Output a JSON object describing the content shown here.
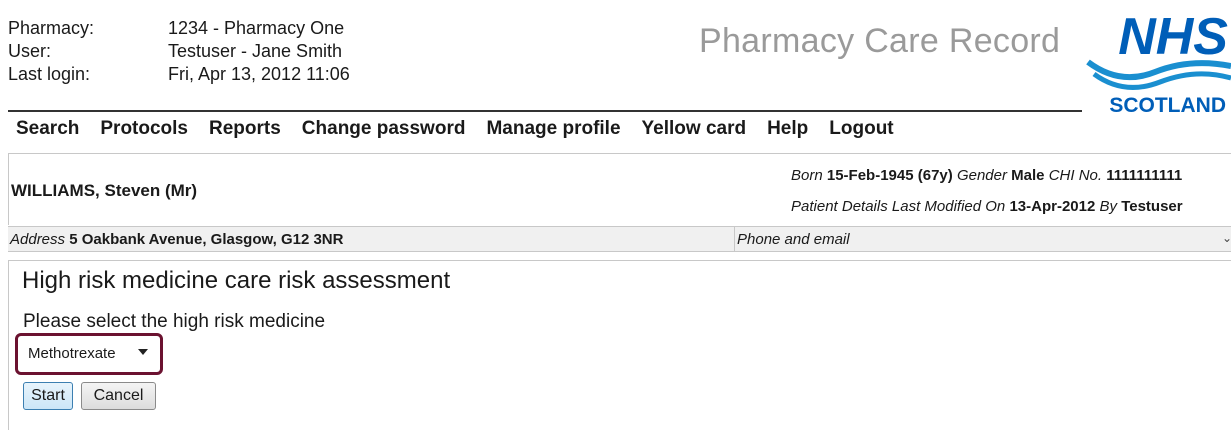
{
  "header": {
    "pharmacy_label": "Pharmacy:",
    "pharmacy_value": "1234 - Pharmacy One",
    "user_label": "User:",
    "user_value": "Testuser - Jane Smith",
    "last_login_label": "Last login:",
    "last_login_value": "Fri, Apr 13, 2012 11:06",
    "app_title": "Pharmacy Care Record",
    "logo_top": "NHS",
    "logo_bottom": "SCOTLAND"
  },
  "menu": [
    "Search",
    "Protocols",
    "Reports",
    "Change password",
    "Manage profile",
    "Yellow card",
    "Help",
    "Logout"
  ],
  "patient": {
    "name": "WILLIAMS, Steven (Mr)",
    "born_label": "Born",
    "born_value": "15-Feb-1945",
    "age": "(67y)",
    "gender_label": "Gender",
    "gender_value": "Male",
    "chi_label": "CHI No.",
    "chi_value": "1111111111",
    "modified_label": "Patient Details Last Modified On",
    "modified_value": "13-Apr-2012",
    "by_label": "By",
    "by_value": "Testuser",
    "address_label": "Address",
    "address_value": "5 Oakbank Avenue, Glasgow, G12 3NR",
    "phone_label": "Phone and email"
  },
  "form": {
    "heading": "High risk medicine care risk assessment",
    "prompt": "Please select the high risk medicine",
    "selected_medicine": "Methotrexate",
    "start_label": "Start",
    "cancel_label": "Cancel"
  },
  "colors": {
    "nhs_blue": "#005eb8",
    "highlight": "#6b1230",
    "title_gray": "#9a9a9a"
  }
}
